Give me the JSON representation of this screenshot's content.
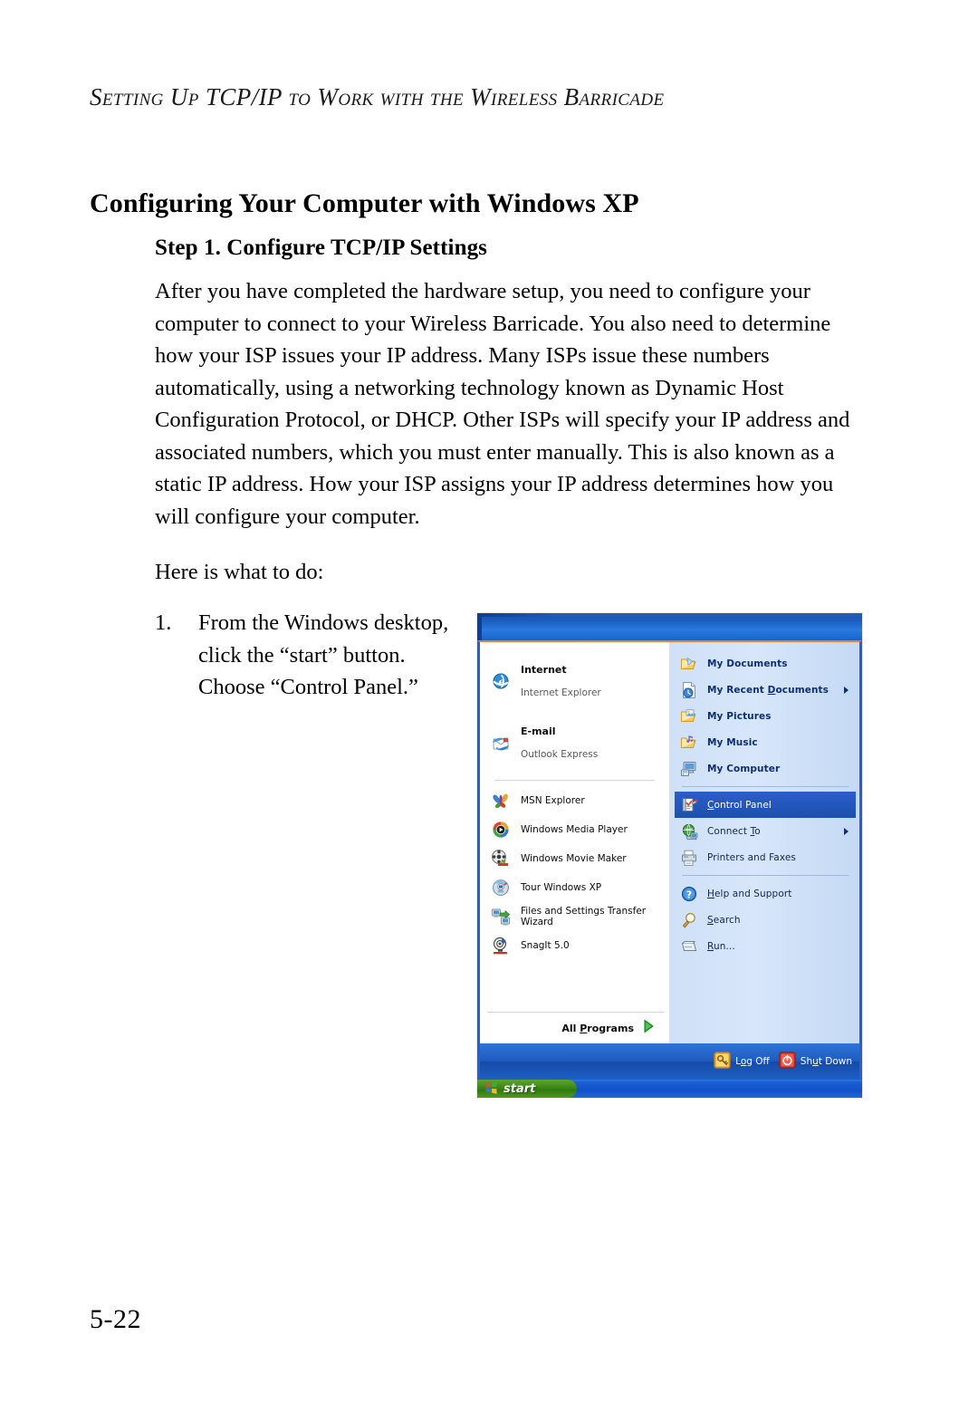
{
  "page": {
    "running_head": "Setting Up TCP/IP to Work with the Wireless Barricade",
    "heading": "Configuring Your Computer with Windows XP",
    "folio": "5-22"
  },
  "section": {
    "subheading": "Step 1. Configure TCP/IP Settings",
    "paragraph_1": "After you have completed the hardware setup, you need to configure your computer to connect to your Wireless Barricade. You also need to determine how your ISP issues your IP address. Many ISPs issue these numbers automatically, using a networking technology known as Dynamic Host Configuration Protocol, or DHCP. Other ISPs will specify your IP address and associated numbers, which you must enter manually. This is also known as a static IP address. How your ISP assigns your IP address determines how you will configure your computer.",
    "paragraph_2": "Here is what to do:"
  },
  "steps": [
    {
      "number": "1.",
      "text": "From the Windows desktop, click the “start” button. Choose “Control Panel.”"
    }
  ],
  "screenshot": {
    "caption_alt": "Windows XP Start menu with Control Panel highlighted",
    "colors": {
      "header_blue": "#1a5ec0",
      "right_panel_blue": "#cfe0f7",
      "selection_blue": "#1d4faf",
      "orange_rule": "#f08020",
      "start_green": "#3d8a19",
      "taskbar_blue": "#1350c8"
    },
    "left_column": {
      "pinned": [
        {
          "title": "Internet",
          "subtitle": "Internet Explorer",
          "icon": "internet-explorer-icon"
        },
        {
          "title": "E-mail",
          "subtitle": "Outlook Express",
          "icon": "outlook-express-icon"
        }
      ],
      "recent": [
        {
          "title": "MSN Explorer",
          "icon": "msn-explorer-icon"
        },
        {
          "title": "Windows Media Player",
          "icon": "windows-media-player-icon"
        },
        {
          "title": "Windows Movie Maker",
          "icon": "windows-movie-maker-icon"
        },
        {
          "title": "Tour Windows XP",
          "icon": "tour-windows-xp-icon"
        },
        {
          "title": "Files and Settings Transfer Wizard",
          "icon": "files-settings-transfer-wizard-icon"
        },
        {
          "title": "SnagIt 5.0",
          "icon": "snagit-icon"
        }
      ],
      "all_programs": "All Programs"
    },
    "right_column": {
      "group_1": [
        {
          "label": "My Documents",
          "icon": "my-documents-icon",
          "submenu": false,
          "selected": false
        },
        {
          "label": "My Recent Documents",
          "icon": "my-recent-documents-icon",
          "submenu": true,
          "selected": false
        },
        {
          "label": "My Pictures",
          "icon": "my-pictures-icon",
          "submenu": false,
          "selected": false
        },
        {
          "label": "My Music",
          "icon": "my-music-icon",
          "submenu": false,
          "selected": false
        },
        {
          "label": "My Computer",
          "icon": "my-computer-icon",
          "submenu": false,
          "selected": false
        }
      ],
      "group_2": [
        {
          "label": "Control Panel",
          "icon": "control-panel-icon",
          "submenu": false,
          "selected": true
        },
        {
          "label": "Connect To",
          "icon": "connect-to-icon",
          "submenu": true,
          "selected": false
        },
        {
          "label": "Printers and Faxes",
          "icon": "printers-and-faxes-icon",
          "submenu": false,
          "selected": false
        }
      ],
      "group_3": [
        {
          "label": "Help and Support",
          "icon": "help-and-support-icon",
          "submenu": false,
          "selected": false
        },
        {
          "label": "Search",
          "icon": "search-icon",
          "submenu": false,
          "selected": false
        },
        {
          "label": "Run...",
          "icon": "run-icon",
          "submenu": false,
          "selected": false
        }
      ]
    },
    "footer": {
      "log_off": "Log Off",
      "shut_down": "Shut Down"
    },
    "taskbar": {
      "start_label": "start"
    }
  }
}
